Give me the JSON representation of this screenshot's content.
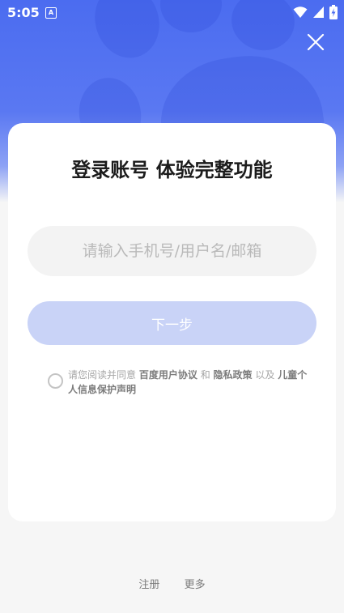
{
  "status_bar": {
    "time": "5:05",
    "notification_icon_letter": "A"
  },
  "login_card": {
    "title": "登录账号 体验完整功能",
    "account_input_placeholder": "请输入手机号/用户名/邮箱",
    "account_input_value": "",
    "next_button_label": "下一步",
    "agreement": {
      "prefix": "请您阅读并同意",
      "link_user_agreement": "百度用户协议",
      "conjunction": "和",
      "link_privacy_policy": "隐私政策",
      "suffix": "以及",
      "link_children_privacy": "儿童个人信息保护声明",
      "checked": false
    }
  },
  "footer": {
    "register_label": "注册",
    "more_label": "更多"
  },
  "colors": {
    "header_blue": "#4b6cf0",
    "button_disabled": "#c9d3f7",
    "page_background": "#f6f6f6"
  },
  "icons": {
    "close": "close-icon",
    "wifi": "wifi-icon",
    "signal": "cellular-signal-icon",
    "battery": "battery-charging-icon"
  }
}
